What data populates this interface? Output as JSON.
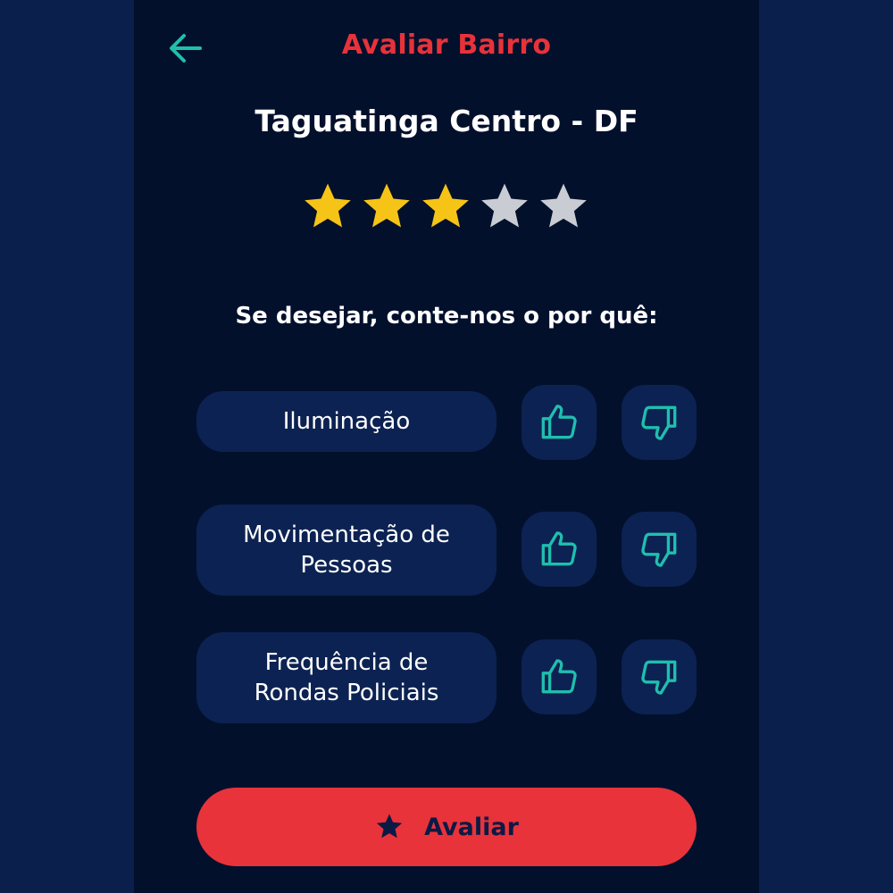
{
  "header": {
    "title": "Avaliar Bairro",
    "back_icon": "arrow-left-icon"
  },
  "location": "Taguatinga Centro - DF",
  "rating": {
    "value": 3,
    "max": 5,
    "filled_color": "#f5c417",
    "empty_color": "#c9ccd3"
  },
  "prompt": "Se desejar, conte-nos o por quê:",
  "categories": [
    {
      "label_lines": [
        "Iluminação"
      ],
      "up_icon": "thumbs-up-icon",
      "down_icon": "thumbs-down-icon"
    },
    {
      "label_lines": [
        "Movimentação de",
        "Pessoas"
      ],
      "up_icon": "thumbs-up-icon",
      "down_icon": "thumbs-down-icon"
    },
    {
      "label_lines": [
        "Frequência de",
        "Rondas Policiais"
      ],
      "up_icon": "thumbs-up-icon",
      "down_icon": "thumbs-down-icon"
    }
  ],
  "submit": {
    "label": "Avaliar",
    "icon": "star-icon"
  },
  "colors": {
    "accent_red": "#e8323a",
    "accent_teal": "#1fbfae",
    "page_bg": "#03102c",
    "card_bg": "#0c2252"
  }
}
